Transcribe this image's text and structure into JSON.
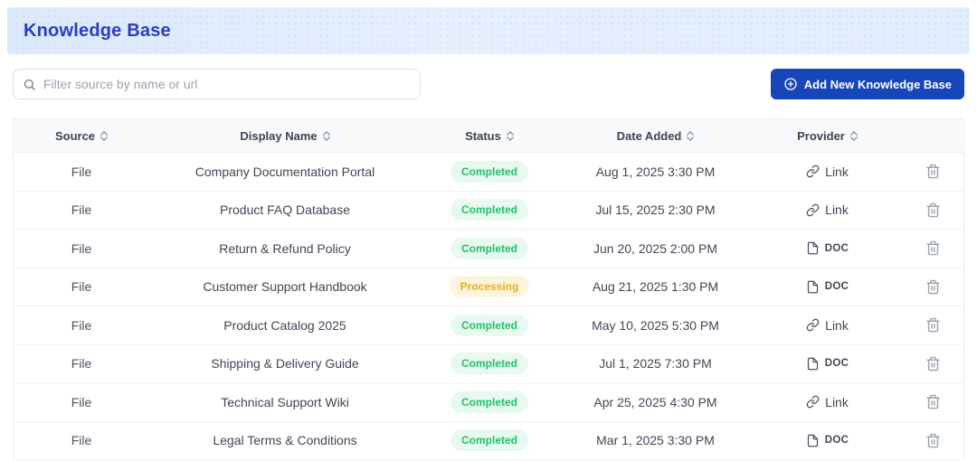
{
  "page": {
    "title": "Knowledge Base"
  },
  "toolbar": {
    "filter_placeholder": "Filter source by name or url",
    "add_button_label": "Add New Knowledge Base"
  },
  "table": {
    "columns": [
      {
        "label": "Source",
        "sortable": true
      },
      {
        "label": "Display Name",
        "sortable": true
      },
      {
        "label": "Status",
        "sortable": true
      },
      {
        "label": "Date Added",
        "sortable": true
      },
      {
        "label": "Provider",
        "sortable": true
      },
      {
        "label": "",
        "sortable": false
      }
    ],
    "rows": [
      {
        "source": "File",
        "display_name": "Company Documentation Portal",
        "status": "Completed",
        "date_added": "Aug 1, 2025 3:30 PM",
        "provider": "Link",
        "provider_type": "link"
      },
      {
        "source": "File",
        "display_name": "Product FAQ Database",
        "status": "Completed",
        "date_added": "Jul 15, 2025 2:30 PM",
        "provider": "Link",
        "provider_type": "link"
      },
      {
        "source": "File",
        "display_name": "Return & Refund Policy",
        "status": "Completed",
        "date_added": "Jun 20, 2025 2:00 PM",
        "provider": "DOC",
        "provider_type": "doc"
      },
      {
        "source": "File",
        "display_name": "Customer Support Handbook",
        "status": "Processing",
        "date_added": "Aug 21, 2025 1:30 PM",
        "provider": "DOC",
        "provider_type": "doc"
      },
      {
        "source": "File",
        "display_name": "Product Catalog 2025",
        "status": "Completed",
        "date_added": "May 10, 2025 5:30 PM",
        "provider": "Link",
        "provider_type": "link"
      },
      {
        "source": "File",
        "display_name": "Shipping & Delivery Guide",
        "status": "Completed",
        "date_added": "Jul 1, 2025 7:30 PM",
        "provider": "DOC",
        "provider_type": "doc"
      },
      {
        "source": "File",
        "display_name": "Technical Support Wiki",
        "status": "Completed",
        "date_added": "Apr 25, 2025 4:30 PM",
        "provider": "Link",
        "provider_type": "link"
      },
      {
        "source": "File",
        "display_name": "Legal Terms & Conditions",
        "status": "Completed",
        "date_added": "Mar 1, 2025 3:30 PM",
        "provider": "DOC",
        "provider_type": "doc"
      }
    ]
  },
  "status_styles": {
    "Completed": {
      "text": "#22c06a",
      "bg": "#e8f9f0"
    },
    "Processing": {
      "text": "#edb012",
      "bg": "#fcf4dc"
    }
  },
  "colors": {
    "title_blue": "#2b3bc7",
    "accent_button_blue": "#1646b8",
    "header_band_blue": "#dce9fb"
  },
  "icons": {
    "search": "search-icon",
    "add": "plus-circle-icon",
    "sort": "sort-icon",
    "link": "link-icon",
    "doc": "file-doc-icon",
    "delete": "trash-icon"
  }
}
